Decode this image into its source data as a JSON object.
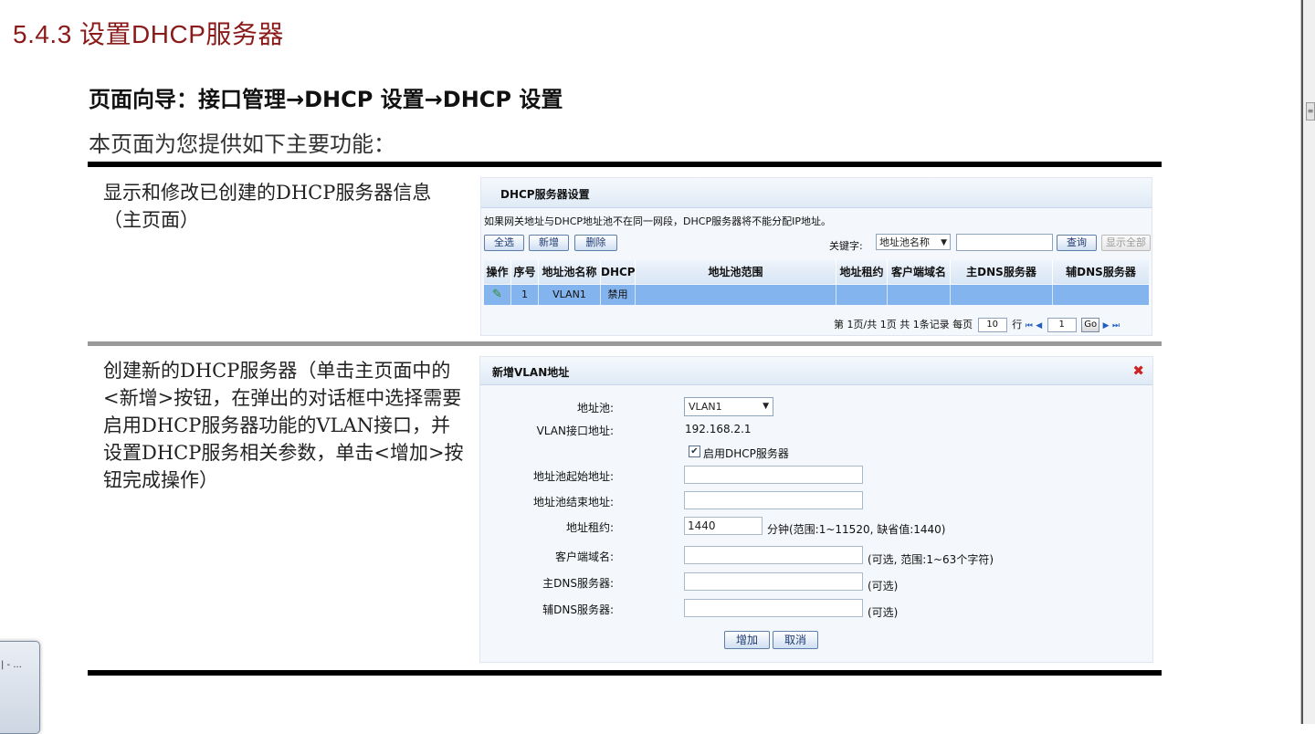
{
  "section_title": "5.4.3  设置DHCP服务器",
  "nav_guide": "页面向导：接口管理→DHCP 设置→DHCP 设置",
  "intro": "本页面为您提供如下主要功能：",
  "descriptions": [
    "显示和修改已创建的DHCP服务器信息（主页面）",
    "创建新的DHCP服务器（单击主页面中的<新增>按钮，在弹出的对话框中选择需要启用DHCP服务器功能的VLAN接口，并设置DHCP服务相关参数，单击<增加>按钮完成操作）"
  ],
  "panel1": {
    "title": "DHCP服务器设置",
    "notice": "如果网关地址与DHCP地址池不在同一网段，DHCP服务器将不能分配IP地址。",
    "buttons": {
      "select_all": "全选",
      "add": "新增",
      "delete": "删除",
      "query": "查询",
      "show_all": "显示全部"
    },
    "keyword_label": "关键字:",
    "keyword_select": "地址池名称",
    "columns": [
      "操作",
      "序号",
      "地址池名称",
      "DHCP",
      "地址池范围",
      "地址租约",
      "客户端域名",
      "主DNS服务器",
      "辅DNS服务器"
    ],
    "rows": [
      {
        "index": "1",
        "pool_name": "VLAN1",
        "dhcp": "禁用",
        "range": "",
        "lease": "",
        "domain": "",
        "dns1": "",
        "dns2": ""
      }
    ],
    "pager": {
      "text_prefix": "第 1页/共 1页 共 1条记录 每页",
      "per_page": "10",
      "text_suffix": "行",
      "page_input": "1",
      "go_label": "Go"
    }
  },
  "panel2": {
    "title": "新增VLAN地址",
    "fields": {
      "pool_label": "地址池:",
      "pool_value": "VLAN1",
      "vlan_ip_label": "VLAN接口地址:",
      "vlan_ip_value": "192.168.2.1",
      "enable_label": "启用DHCP服务器",
      "start_label": "地址池起始地址:",
      "end_label": "地址池结束地址:",
      "lease_label": "地址租约:",
      "lease_value": "1440",
      "lease_hint": "分钟(范围:1~11520, 缺省值:1440)",
      "domain_label": "客户端域名:",
      "domain_hint": "(可选, 范围:1~63个字符)",
      "dns1_label": "主DNS服务器:",
      "dns1_hint": "(可选)",
      "dns2_label": "辅DNS服务器:",
      "dns2_hint": "(可选)"
    },
    "buttons": {
      "add": "增加",
      "cancel": "取消"
    }
  },
  "taskbar_popup_text": "| - ..."
}
